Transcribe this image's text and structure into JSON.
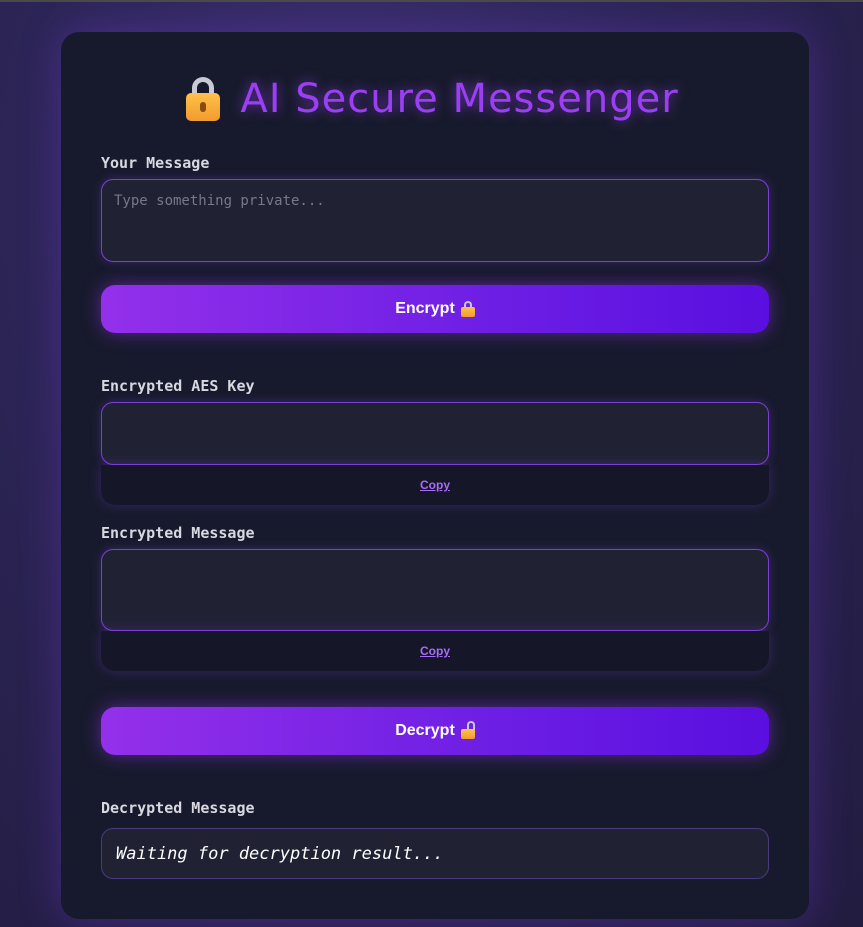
{
  "header": {
    "title": "AI Secure Messenger",
    "icon": "lock-icon"
  },
  "message": {
    "label": "Your Message",
    "placeholder": "Type something private..."
  },
  "encrypt_button": {
    "label": "Encrypt",
    "icon": "locked-icon"
  },
  "aes_key": {
    "label": "Encrypted AES Key",
    "copy_label": "Copy"
  },
  "encrypted_message": {
    "label": "Encrypted Message",
    "copy_label": "Copy"
  },
  "decrypt_button": {
    "label": "Decrypt",
    "icon": "unlocked-icon"
  },
  "decrypted": {
    "label": "Decrypted Message",
    "result": "Waiting for decryption result..."
  },
  "colors": {
    "accent": "#9b3ff2",
    "button_start": "#9330ea",
    "button_end": "#5a0fe0",
    "card": "#171a2c"
  }
}
